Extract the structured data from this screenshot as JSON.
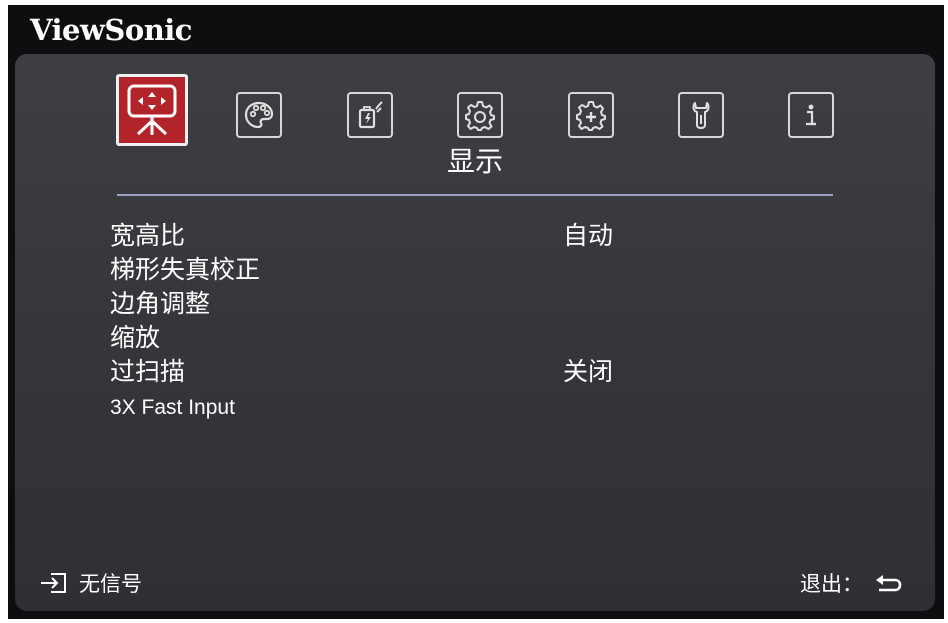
{
  "brand": "ViewSonic",
  "tabs": [
    {
      "icon": "display-icon",
      "active": true
    },
    {
      "icon": "palette-icon",
      "active": false
    },
    {
      "icon": "power-icon",
      "active": false
    },
    {
      "icon": "gear-icon",
      "active": false
    },
    {
      "icon": "advanced-gear-icon",
      "active": false
    },
    {
      "icon": "wrench-icon",
      "active": false
    },
    {
      "icon": "info-icon",
      "active": false
    }
  ],
  "section_title": "显示",
  "menu": [
    {
      "label": "宽高比",
      "value": "自动"
    },
    {
      "label": "梯形失真校正",
      "value": ""
    },
    {
      "label": "边角调整",
      "value": ""
    },
    {
      "label": "缩放",
      "value": ""
    },
    {
      "label": "过扫描",
      "value": "关闭"
    },
    {
      "label": "3X Fast Input",
      "value": ""
    }
  ],
  "footer": {
    "input_status": "无信号",
    "exit_label": "退出："
  },
  "colors": {
    "accent": "#b3242a",
    "panel": "#3a3c40",
    "frame": "#0e0e10",
    "divider": "#9aa3c2"
  }
}
